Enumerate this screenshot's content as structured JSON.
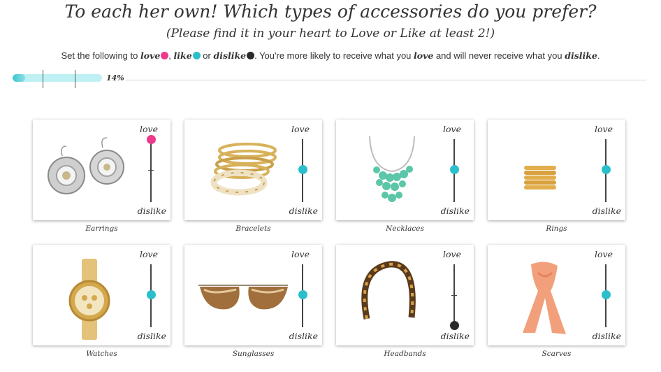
{
  "title": "To each her own! Which types of accessories do you prefer?",
  "subtitle": "(Please find it in your heart to Love or Like at least 2!)",
  "instructions": {
    "prefix": "Set the following to ",
    "love_word": "love",
    "sep1": ", ",
    "like_word": "like",
    "sep2": " or ",
    "dislike_word": "dislike",
    "middle": ". You're more likely to receive what you ",
    "love_word2": "love",
    "middle2": " and will never receive what you ",
    "dislike_word2": "dislike",
    "suffix": "."
  },
  "colors": {
    "love": "#ee3a8c",
    "like": "#2bbfcc",
    "dislike": "#2b2b2b",
    "accent": "#3bc6cf"
  },
  "progress": {
    "label": "14%",
    "value": 0.14
  },
  "slider_labels": {
    "top": "love",
    "bottom": "dislike"
  },
  "items": [
    {
      "name": "Earrings",
      "rating": "love",
      "icon": "earrings-image"
    },
    {
      "name": "Bracelets",
      "rating": "like",
      "icon": "bracelets-image"
    },
    {
      "name": "Necklaces",
      "rating": "like",
      "icon": "necklace-image"
    },
    {
      "name": "Rings",
      "rating": "like",
      "icon": "rings-image"
    },
    {
      "name": "Watches",
      "rating": "like",
      "icon": "watch-image"
    },
    {
      "name": "Sunglasses",
      "rating": "like",
      "icon": "sunglasses-image"
    },
    {
      "name": "Headbands",
      "rating": "dislike",
      "icon": "headband-image"
    },
    {
      "name": "Scarves",
      "rating": "like",
      "icon": "scarf-image"
    }
  ]
}
